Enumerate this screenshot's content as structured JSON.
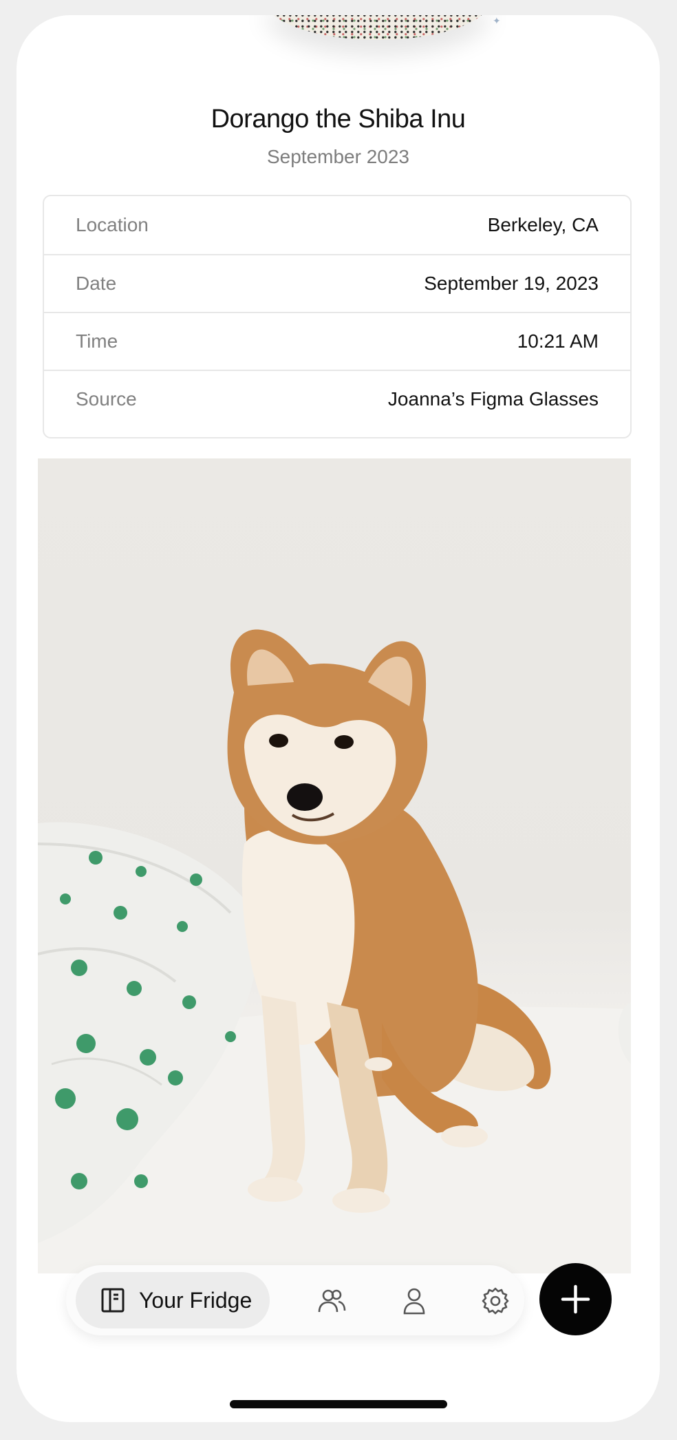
{
  "header": {
    "title": "Dorango the Shiba Inu",
    "subtitle": "September 2023"
  },
  "details": [
    {
      "label": "Location",
      "value": "Berkeley, CA"
    },
    {
      "label": "Date",
      "value": "September 19, 2023"
    },
    {
      "label": "Time",
      "value": "10:21 AM"
    },
    {
      "label": "Source",
      "value": "Joanna’s Figma Glasses"
    }
  ],
  "photo": {
    "subject": "shiba-inu-dog"
  },
  "nav": {
    "active_label": "Your Fridge",
    "icons": [
      "fridge-icon",
      "people-icon",
      "person-icon",
      "gear-icon"
    ]
  },
  "fab": {
    "icon": "plus-icon"
  },
  "colors": {
    "background": "#efefef",
    "surface": "#ffffff",
    "nav_active": "#ececec",
    "fab": "#050505",
    "muted_text": "#808080"
  }
}
